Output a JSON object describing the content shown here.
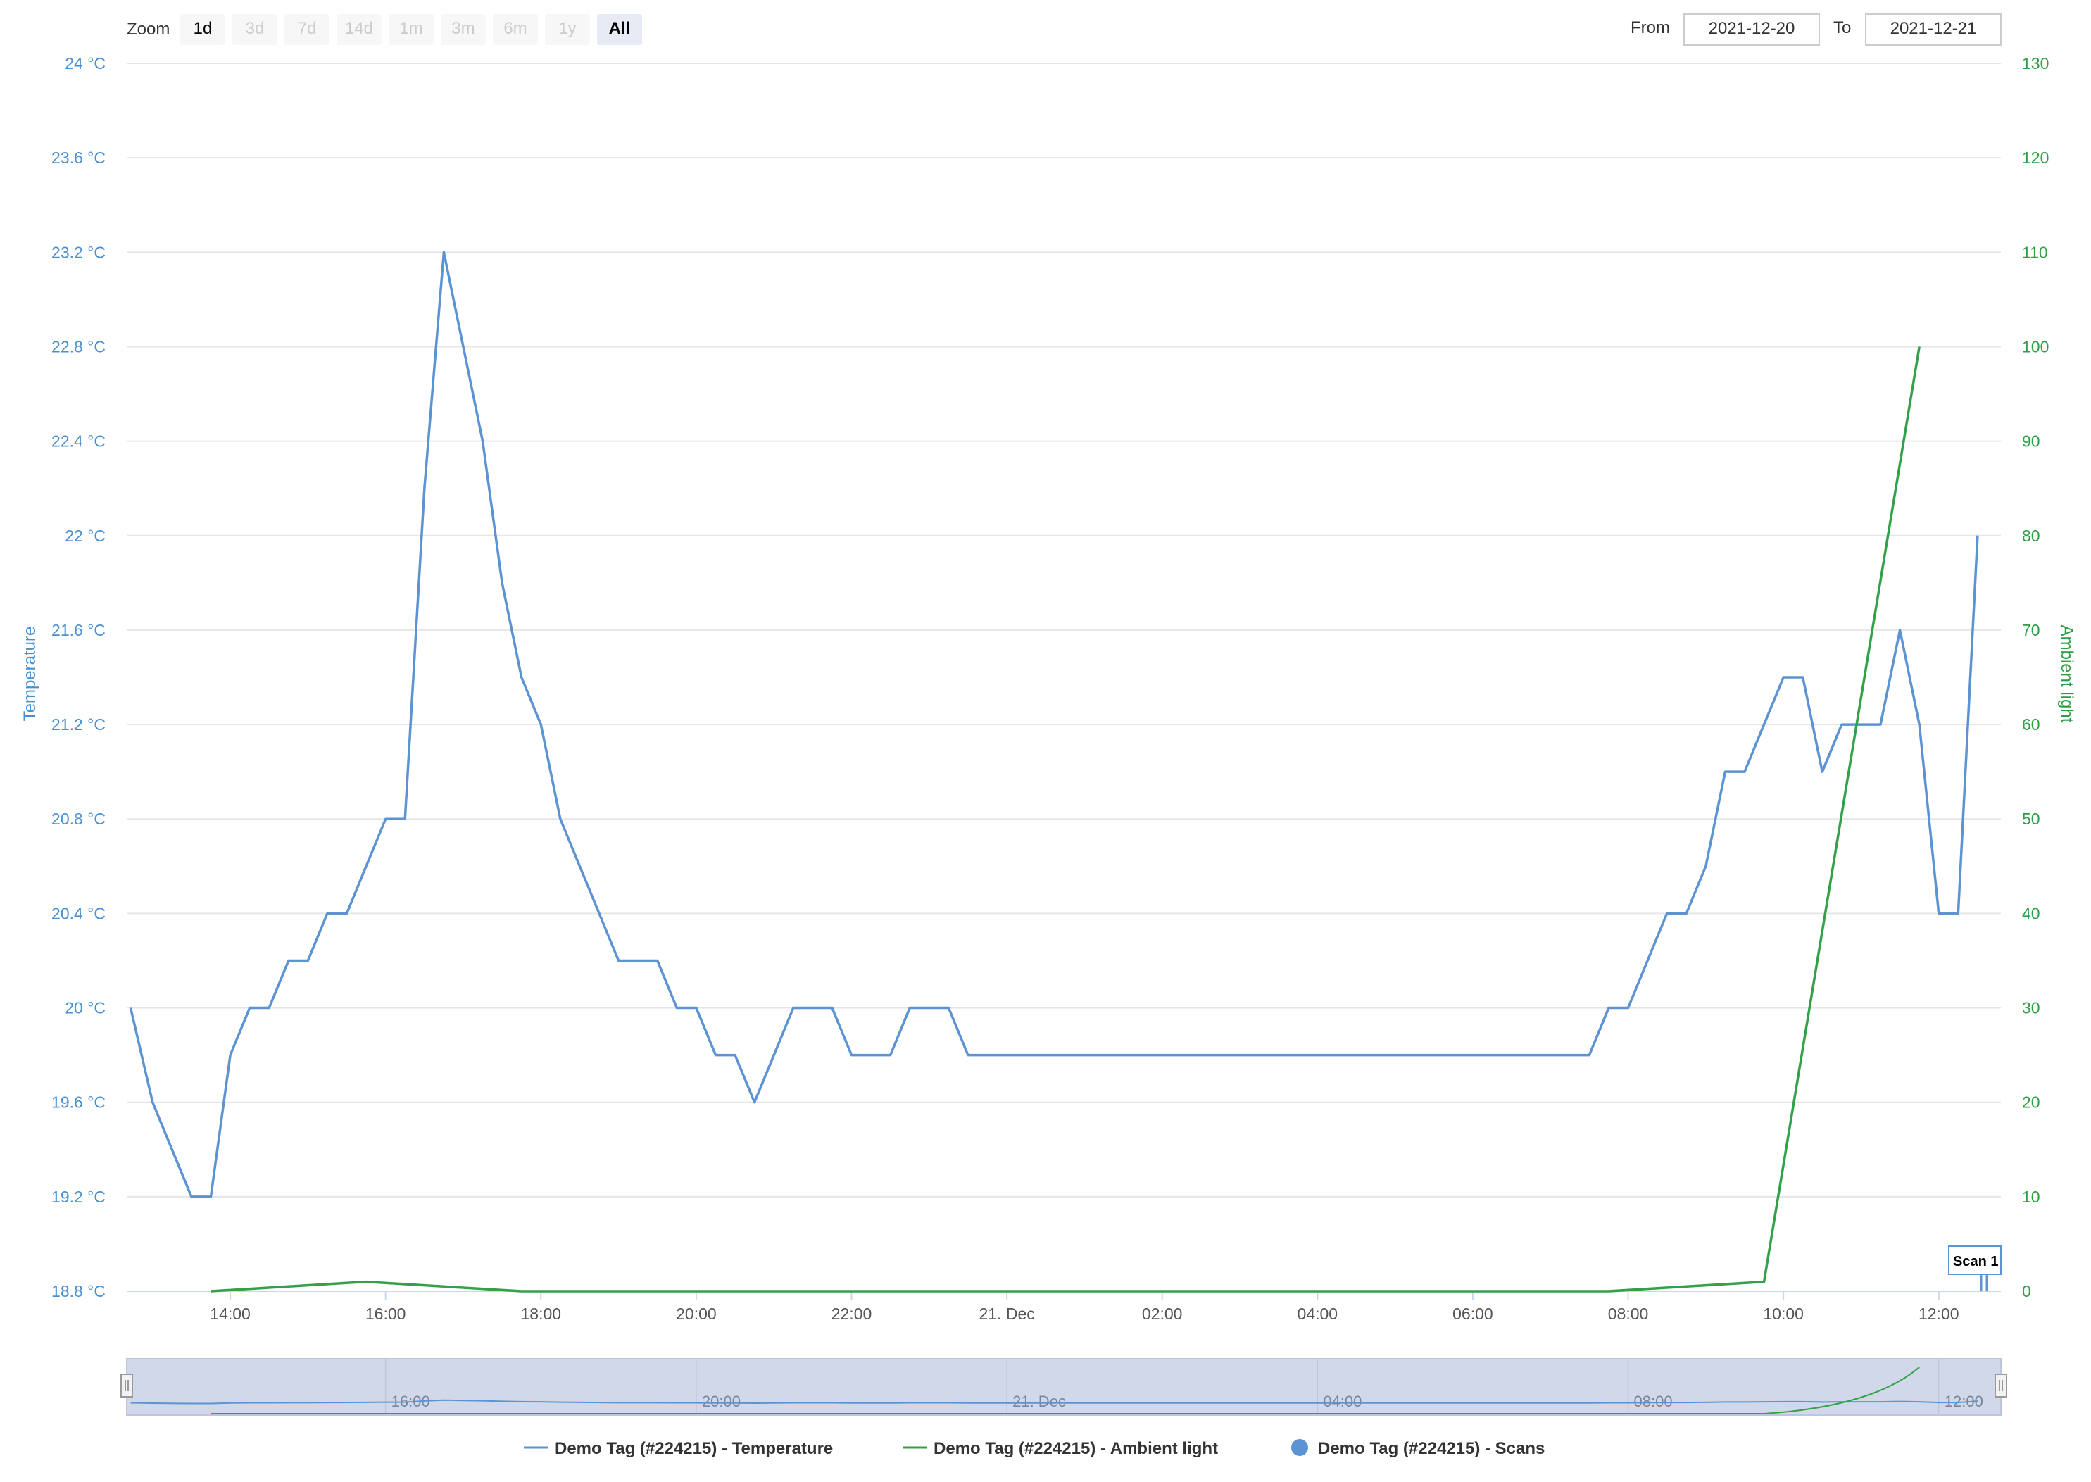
{
  "toolbar": {
    "zoom_label": "Zoom",
    "zoom_buttons": [
      {
        "label": "1d",
        "state": "enabled"
      },
      {
        "label": "3d",
        "state": "disabled"
      },
      {
        "label": "7d",
        "state": "disabled"
      },
      {
        "label": "14d",
        "state": "disabled"
      },
      {
        "label": "1m",
        "state": "disabled"
      },
      {
        "label": "3m",
        "state": "disabled"
      },
      {
        "label": "6m",
        "state": "disabled"
      },
      {
        "label": "1y",
        "state": "disabled"
      },
      {
        "label": "All",
        "state": "selected"
      }
    ],
    "from_label": "From",
    "from_value": "2021-12-20",
    "to_label": "To",
    "to_value": "2021-12-21"
  },
  "scan_flag": {
    "label": "Scan 1"
  },
  "navigator": {
    "labels": [
      "16:00",
      "20:00",
      "21. Dec",
      "04:00",
      "08:00",
      "12:00"
    ]
  },
  "colors": {
    "temperature": "#5b93d3",
    "ambient": "#33a04a",
    "scans": "#5b93d3",
    "grid": "#e6e6e6",
    "navigator_mask": "#d0d8ea"
  },
  "chart_data": {
    "type": "line",
    "x_axis": {
      "type": "datetime",
      "range": [
        "2021-12-20 12:40",
        "2021-12-21 12:48"
      ],
      "tick_labels": [
        "14:00",
        "16:00",
        "18:00",
        "20:00",
        "22:00",
        "21. Dec",
        "02:00",
        "04:00",
        "06:00",
        "08:00",
        "10:00",
        "12:00"
      ]
    },
    "y_axes": [
      {
        "side": "left",
        "title": "Temperature",
        "unit": "°C",
        "ylim": [
          18.8,
          24
        ],
        "tick_labels": [
          "18.8 °C",
          "19.2 °C",
          "19.6 °C",
          "20 °C",
          "20.4 °C",
          "20.8 °C",
          "21.2 °C",
          "21.6 °C",
          "22 °C",
          "22.4 °C",
          "22.8 °C",
          "23.2 °C",
          "23.6 °C",
          "24 °C"
        ]
      },
      {
        "side": "right",
        "title": "Ambient light",
        "ylim": [
          0,
          130
        ],
        "tick_labels": [
          "0",
          "10",
          "20",
          "30",
          "40",
          "50",
          "60",
          "70",
          "80",
          "90",
          "100",
          "110",
          "120",
          "130"
        ]
      }
    ],
    "grid": true,
    "legend_position": "bottom-center",
    "series": [
      {
        "name": "Demo Tag (#224215) - Temperature",
        "axis": "left",
        "x": [
          "2021-12-20 12:43",
          "2021-12-20 13:00",
          "2021-12-20 13:30",
          "2021-12-20 13:45",
          "2021-12-20 14:00",
          "2021-12-20 14:15",
          "2021-12-20 14:30",
          "2021-12-20 14:45",
          "2021-12-20 15:00",
          "2021-12-20 15:15",
          "2021-12-20 15:30",
          "2021-12-20 15:45",
          "2021-12-20 16:00",
          "2021-12-20 16:15",
          "2021-12-20 16:30",
          "2021-12-20 16:45",
          "2021-12-20 17:00",
          "2021-12-20 17:15",
          "2021-12-20 17:30",
          "2021-12-20 17:45",
          "2021-12-20 18:00",
          "2021-12-20 18:15",
          "2021-12-20 18:45",
          "2021-12-20 19:00",
          "2021-12-20 19:15",
          "2021-12-20 19:30",
          "2021-12-20 19:45",
          "2021-12-20 20:00",
          "2021-12-20 20:15",
          "2021-12-20 20:30",
          "2021-12-20 20:45",
          "2021-12-20 21:15",
          "2021-12-20 21:30",
          "2021-12-20 21:45",
          "2021-12-20 22:00",
          "2021-12-20 22:15",
          "2021-12-20 22:30",
          "2021-12-20 22:45",
          "2021-12-20 23:00",
          "2021-12-20 23:15",
          "2021-12-20 23:30",
          "2021-12-21 00:00",
          "2021-12-21 07:30",
          "2021-12-21 07:45",
          "2021-12-21 08:00",
          "2021-12-21 08:30",
          "2021-12-21 08:45",
          "2021-12-21 09:00",
          "2021-12-21 09:15",
          "2021-12-21 09:30",
          "2021-12-21 09:45",
          "2021-12-21 10:00",
          "2021-12-21 10:15",
          "2021-12-21 10:30",
          "2021-12-21 10:45",
          "2021-12-21 11:00",
          "2021-12-21 11:15",
          "2021-12-21 11:30",
          "2021-12-21 11:45",
          "2021-12-21 12:00",
          "2021-12-21 12:15",
          "2021-12-21 12:30"
        ],
        "y": [
          20.0,
          19.6,
          19.2,
          19.2,
          19.8,
          20.0,
          20.0,
          20.2,
          20.2,
          20.4,
          20.4,
          20.6,
          20.8,
          20.8,
          22.2,
          23.2,
          22.8,
          22.4,
          21.8,
          21.4,
          21.2,
          20.8,
          20.4,
          20.2,
          20.2,
          20.2,
          20.0,
          20.0,
          19.8,
          19.8,
          19.6,
          20.0,
          20.0,
          20.0,
          19.8,
          19.8,
          19.8,
          20.0,
          20.0,
          20.0,
          19.8,
          19.8,
          19.8,
          20.0,
          20.0,
          20.4,
          20.4,
          20.6,
          21.0,
          21.0,
          21.2,
          21.4,
          21.4,
          21.0,
          21.2,
          21.2,
          21.2,
          21.6,
          21.2,
          20.4,
          20.4,
          22.0
        ]
      },
      {
        "name": "Demo Tag (#224215) - Ambient light",
        "axis": "right",
        "x": [
          "2021-12-20 13:45",
          "2021-12-20 15:45",
          "2021-12-20 17:45",
          "2021-12-21 07:45",
          "2021-12-21 09:45",
          "2021-12-21 11:45"
        ],
        "y": [
          0,
          1,
          0,
          0,
          1,
          100
        ]
      },
      {
        "name": "Demo Tag (#224215) - Scans",
        "type": "flags",
        "x": [
          "2021-12-21 12:40"
        ],
        "labels": [
          "Scan 1"
        ]
      }
    ]
  }
}
